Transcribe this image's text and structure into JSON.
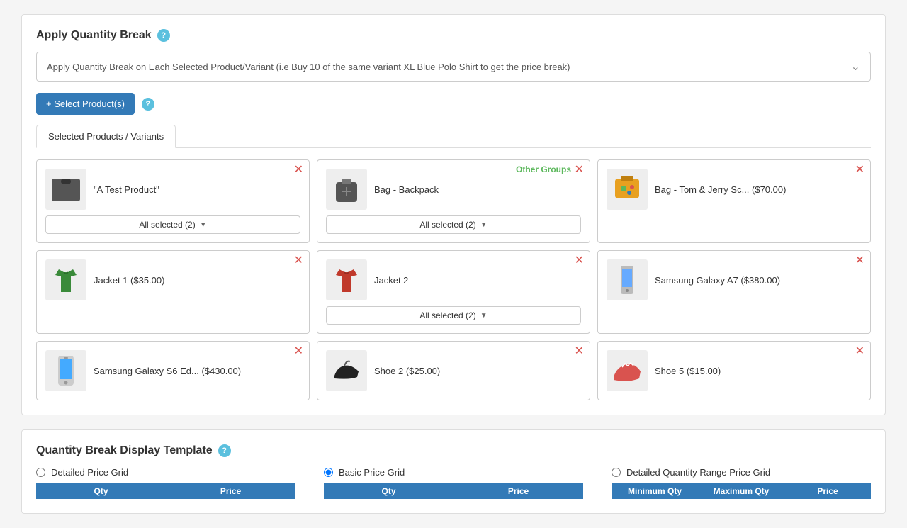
{
  "applyQtyBreak": {
    "title": "Apply Quantity Break",
    "dropdownValue": "Apply Quantity Break on Each Selected Product/Variant (i.e Buy 10 of the same variant XL Blue Polo Shirt to get the price break)",
    "selectButtonLabel": "+ Select Product(s)"
  },
  "selectedProducts": {
    "tabLabel": "Selected Products / Variants",
    "products": [
      {
        "id": "a-test-product",
        "name": "\"A Test Product\"",
        "hasVariantDropdown": true,
        "variantLabel": "All selected (2)",
        "hasOtherGroups": false,
        "imgType": "tshirt"
      },
      {
        "id": "bag-backpack",
        "name": "Bag - Backpack",
        "hasVariantDropdown": true,
        "variantLabel": "All selected (2)",
        "hasOtherGroups": true,
        "otherGroupsLabel": "Other Groups",
        "imgType": "backpack"
      },
      {
        "id": "bag-tom-jerry",
        "name": "Bag - Tom & Jerry Sc... ($70.00)",
        "hasVariantDropdown": false,
        "hasOtherGroups": false,
        "imgType": "schoolbag"
      },
      {
        "id": "jacket1",
        "name": "Jacket 1 ($35.00)",
        "hasVariantDropdown": false,
        "hasOtherGroups": false,
        "imgType": "jacket-green"
      },
      {
        "id": "jacket2",
        "name": "Jacket 2",
        "hasVariantDropdown": true,
        "variantLabel": "All selected (2)",
        "hasOtherGroups": false,
        "imgType": "jacket-red"
      },
      {
        "id": "samsung-a7",
        "name": "Samsung Galaxy A7 ($380.00)",
        "hasVariantDropdown": false,
        "hasOtherGroups": false,
        "imgType": "phone"
      },
      {
        "id": "samsung-s6",
        "name": "Samsung Galaxy S6 Ed... ($430.00)",
        "hasVariantDropdown": false,
        "hasOtherGroups": false,
        "imgType": "phone2"
      },
      {
        "id": "shoe2",
        "name": "Shoe 2 ($25.00)",
        "hasVariantDropdown": false,
        "hasOtherGroups": false,
        "imgType": "shoe"
      },
      {
        "id": "shoe5",
        "name": "Shoe 5 ($15.00)",
        "hasVariantDropdown": false,
        "hasOtherGroups": false,
        "imgType": "sneaker"
      }
    ]
  },
  "templateSection": {
    "title": "Quantity Break Display Template",
    "options": [
      {
        "id": "detailed",
        "label": "Detailed Price Grid",
        "selected": false
      },
      {
        "id": "basic",
        "label": "Basic Price Grid",
        "selected": true
      },
      {
        "id": "detailed-qty",
        "label": "Detailed Quantity Range Price Grid",
        "selected": false
      }
    ],
    "gridHeaders": {
      "basic": [
        "Qty",
        "Price"
      ],
      "detailed": [
        "Qty",
        "Price"
      ],
      "detailedQty": [
        "Minimum Qty",
        "Maximum Qty",
        "Price"
      ]
    }
  },
  "colors": {
    "primary": "#337ab7",
    "danger": "#d9534f",
    "success": "#5cb85c",
    "gridHeader": "#337ab7"
  }
}
